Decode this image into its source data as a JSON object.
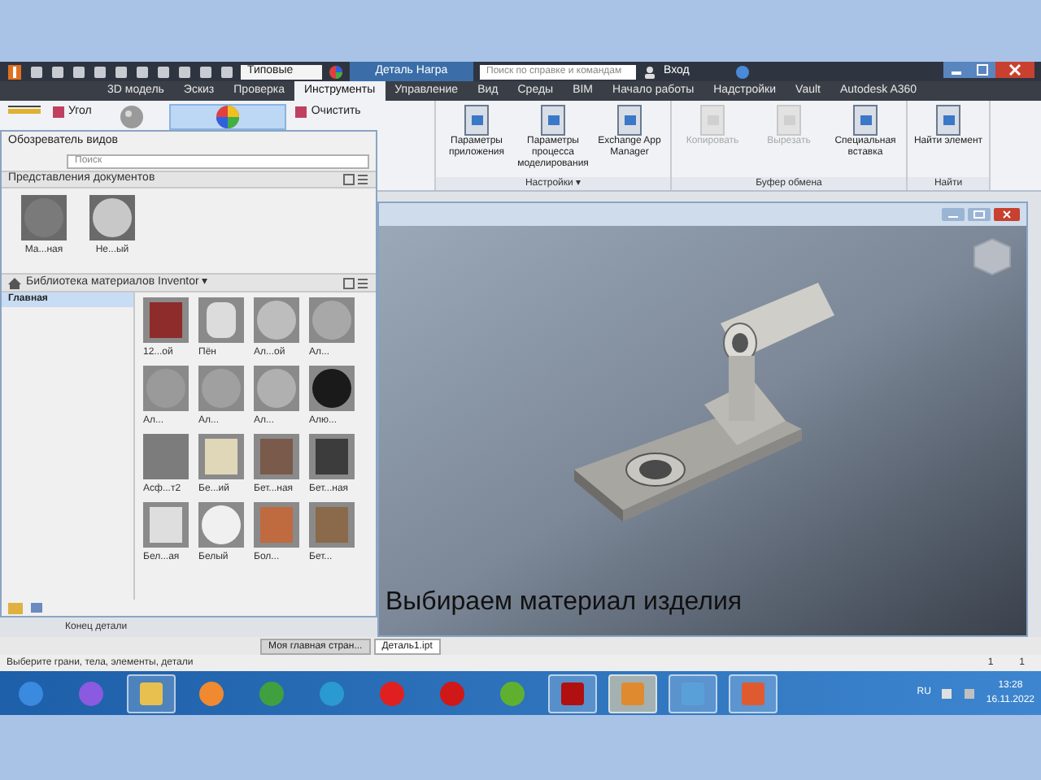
{
  "title_bar": {
    "style_dropdown": "Типовые",
    "document_title": "Деталь Награ",
    "search_placeholder": "Поиск по справке и командам",
    "sign_in": "Вход"
  },
  "tabs": [
    {
      "label": "3D модель",
      "selected": false
    },
    {
      "label": "Эскиз",
      "selected": false
    },
    {
      "label": "Проверка",
      "selected": false
    },
    {
      "label": "Инструменты",
      "selected": true
    },
    {
      "label": "Управление",
      "selected": false
    },
    {
      "label": "Вид",
      "selected": false
    },
    {
      "label": "Среды",
      "selected": false
    },
    {
      "label": "BIM",
      "selected": false
    },
    {
      "label": "Начало работы",
      "selected": false
    },
    {
      "label": "Надстройки",
      "selected": false
    },
    {
      "label": "Vault",
      "selected": false
    },
    {
      "label": "Autodesk A360",
      "selected": false
    }
  ],
  "ribbon": {
    "groups": [
      {
        "buttons": [
          {
            "kind": "small",
            "label": "Угол"
          },
          {
            "kind": "sphere"
          },
          {
            "kind": "colorwheel",
            "selected": true
          },
          {
            "kind": "small",
            "label": "Очистить"
          }
        ]
      },
      {
        "label": "Настройки ▾",
        "buttons": [
          {
            "kind": "large",
            "label": "Параметры приложения",
            "disabled": false
          },
          {
            "kind": "large",
            "label": "Параметры процесса моделирования",
            "disabled": false
          },
          {
            "kind": "large",
            "label": "Exchange App Manager",
            "disabled": false
          }
        ]
      },
      {
        "label": "Буфер обмена",
        "buttons": [
          {
            "kind": "large",
            "label": "Копировать",
            "disabled": true
          },
          {
            "kind": "large",
            "label": "Вырезать",
            "disabled": true
          },
          {
            "kind": "large",
            "label": "Специальная вставка",
            "disabled": false
          }
        ]
      },
      {
        "label": "Найти",
        "buttons": [
          {
            "kind": "large",
            "label": "Найти элемент",
            "disabled": false
          }
        ]
      }
    ]
  },
  "browser_panel": {
    "title": "Обозреватель видов",
    "search_placeholder": "Поиск",
    "document_section": "Представления документов",
    "document_swatches": [
      {
        "label": "Ма...ная",
        "color": "#7a7a7a"
      },
      {
        "label": "Не...ый",
        "color": "#c8c8c8"
      }
    ],
    "library": "Библиотека материалов Inventor ▾",
    "tree": [
      {
        "label": "Главная",
        "selected": true
      }
    ],
    "materials": [
      {
        "label": "12...ой",
        "kind": "cube",
        "color": "#8e2b2b"
      },
      {
        "label": "Пён",
        "kind": "cylinder",
        "color": "#dcdcdc"
      },
      {
        "label": "Ал...ой",
        "kind": "sphere",
        "color": "#bdbdbd"
      },
      {
        "label": "Ал...",
        "kind": "sphere",
        "color": "#a8a8a8"
      },
      {
        "label": "Ал...",
        "kind": "sphere",
        "color": "#9a9a9a"
      },
      {
        "label": "Ал...",
        "kind": "sphere",
        "color": "#a0a0a0"
      },
      {
        "label": "Ал...",
        "kind": "sphere",
        "color": "#b0b0b0"
      },
      {
        "label": "Алю...",
        "kind": "sphere",
        "color": "#1a1a1a"
      },
      {
        "label": "Асф...т2",
        "kind": "flat",
        "color": "#7c7c7c"
      },
      {
        "label": "Бе...ий",
        "kind": "cube",
        "color": "#e0d6b8"
      },
      {
        "label": "Бет...ная",
        "kind": "cube",
        "color": "#7a5a4a"
      },
      {
        "label": "Бет...ная",
        "kind": "cube",
        "color": "#3c3c3c"
      },
      {
        "label": "Бел...ая",
        "kind": "cube",
        "color": "#dedede"
      },
      {
        "label": "Белый",
        "kind": "sphere",
        "color": "#f0f0f0"
      },
      {
        "label": "Бол...",
        "kind": "cube",
        "color": "#c06a40"
      },
      {
        "label": "Бет...",
        "kind": "cube",
        "color": "#8a6a4a"
      }
    ]
  },
  "model_browser": {
    "item": "Конец детали"
  },
  "viewport": {
    "caption": "Выбираем материал изделия"
  },
  "document_tabs": [
    {
      "label": "Моя главная стран...",
      "selected": false
    },
    {
      "label": "Деталь1.ipt",
      "selected": true
    }
  ],
  "status_bar": {
    "message": "Выберите грани, тела, элементы, детали",
    "indicators": [
      "1",
      "1"
    ]
  },
  "taskbar": {
    "apps": [
      {
        "kind": "start",
        "running": false,
        "selected": false
      },
      {
        "kind": "assistant",
        "running": false,
        "selected": false
      },
      {
        "kind": "folder",
        "running": true,
        "selected": false
      },
      {
        "kind": "media",
        "running": false,
        "selected": false
      },
      {
        "kind": "chrome",
        "running": false,
        "selected": false
      },
      {
        "kind": "edge",
        "running": false,
        "selected": false
      },
      {
        "kind": "yandex",
        "running": false,
        "selected": false
      },
      {
        "kind": "opera",
        "running": false,
        "selected": false
      },
      {
        "kind": "torrent",
        "running": false,
        "selected": false
      },
      {
        "kind": "pdf",
        "running": true,
        "selected": false
      },
      {
        "kind": "inventor",
        "running": true,
        "selected": true
      },
      {
        "kind": "photo",
        "running": true,
        "selected": false
      },
      {
        "kind": "slides",
        "running": true,
        "selected": false
      }
    ],
    "language": "RU",
    "time": "13:28",
    "date": "16.11.2022"
  }
}
